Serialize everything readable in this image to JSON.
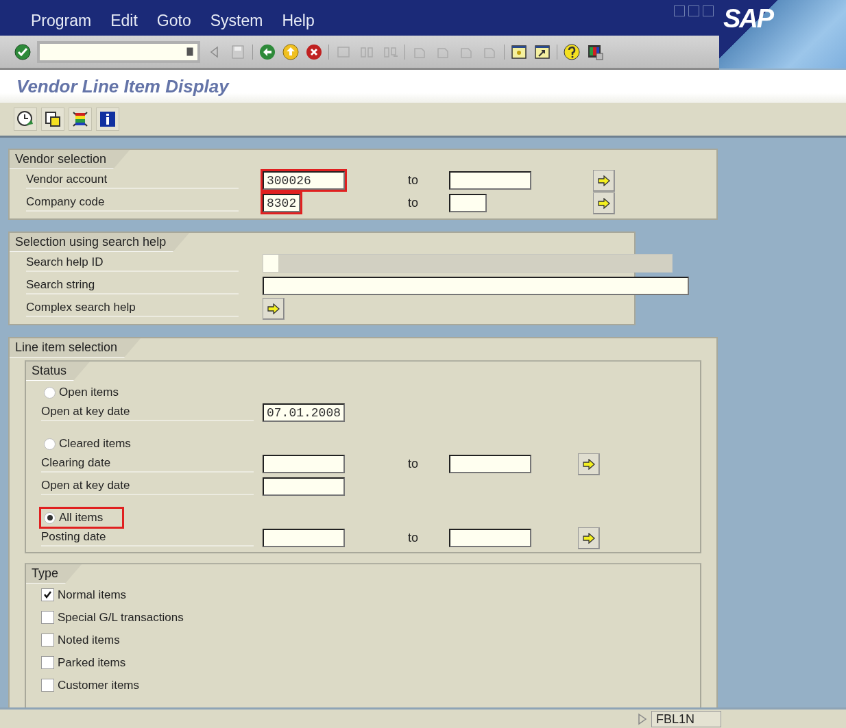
{
  "menu": [
    {
      "label": "Program"
    },
    {
      "label": "Edit"
    },
    {
      "label": "Goto"
    },
    {
      "label": "System"
    },
    {
      "label": "Help"
    }
  ],
  "logo": "SAP",
  "title": "Vendor Line Item Display",
  "vendor_selection": {
    "title": "Vendor selection",
    "rows": [
      {
        "label": "Vendor account",
        "value": "300026",
        "highlighted": true,
        "to": "to"
      },
      {
        "label": "Company code",
        "value": "8302",
        "highlighted": true,
        "to": "to"
      }
    ]
  },
  "search_help": {
    "title": "Selection using search help",
    "rows": [
      {
        "label": "Search help ID",
        "kind": "dropdown"
      },
      {
        "label": "Search string",
        "kind": "text"
      },
      {
        "label": "Complex search help",
        "kind": "button"
      }
    ]
  },
  "line_item_selection": {
    "title": "Line item selection",
    "status": {
      "title": "Status",
      "options": [
        {
          "label": "Open items",
          "selected": false,
          "highlighted": false,
          "fields": [
            {
              "label": "Open at key date",
              "value": "07.01.2008"
            }
          ]
        },
        {
          "label": "Cleared items",
          "selected": false,
          "highlighted": false,
          "fields": [
            {
              "label": "Clearing date",
              "to": "to"
            },
            {
              "label": "Open at key date"
            }
          ]
        },
        {
          "label": "All items",
          "selected": true,
          "highlighted": true,
          "fields": [
            {
              "label": "Posting date",
              "to": "to"
            }
          ]
        }
      ]
    },
    "type": {
      "title": "Type",
      "items": [
        {
          "label": "Normal items",
          "checked": true
        },
        {
          "label": "Special G/L transactions",
          "checked": false
        },
        {
          "label": "Noted items",
          "checked": false
        },
        {
          "label": "Parked items",
          "checked": false
        },
        {
          "label": "Customer items",
          "checked": false
        }
      ]
    }
  },
  "status_bar": {
    "transaction": "FBL1N"
  }
}
